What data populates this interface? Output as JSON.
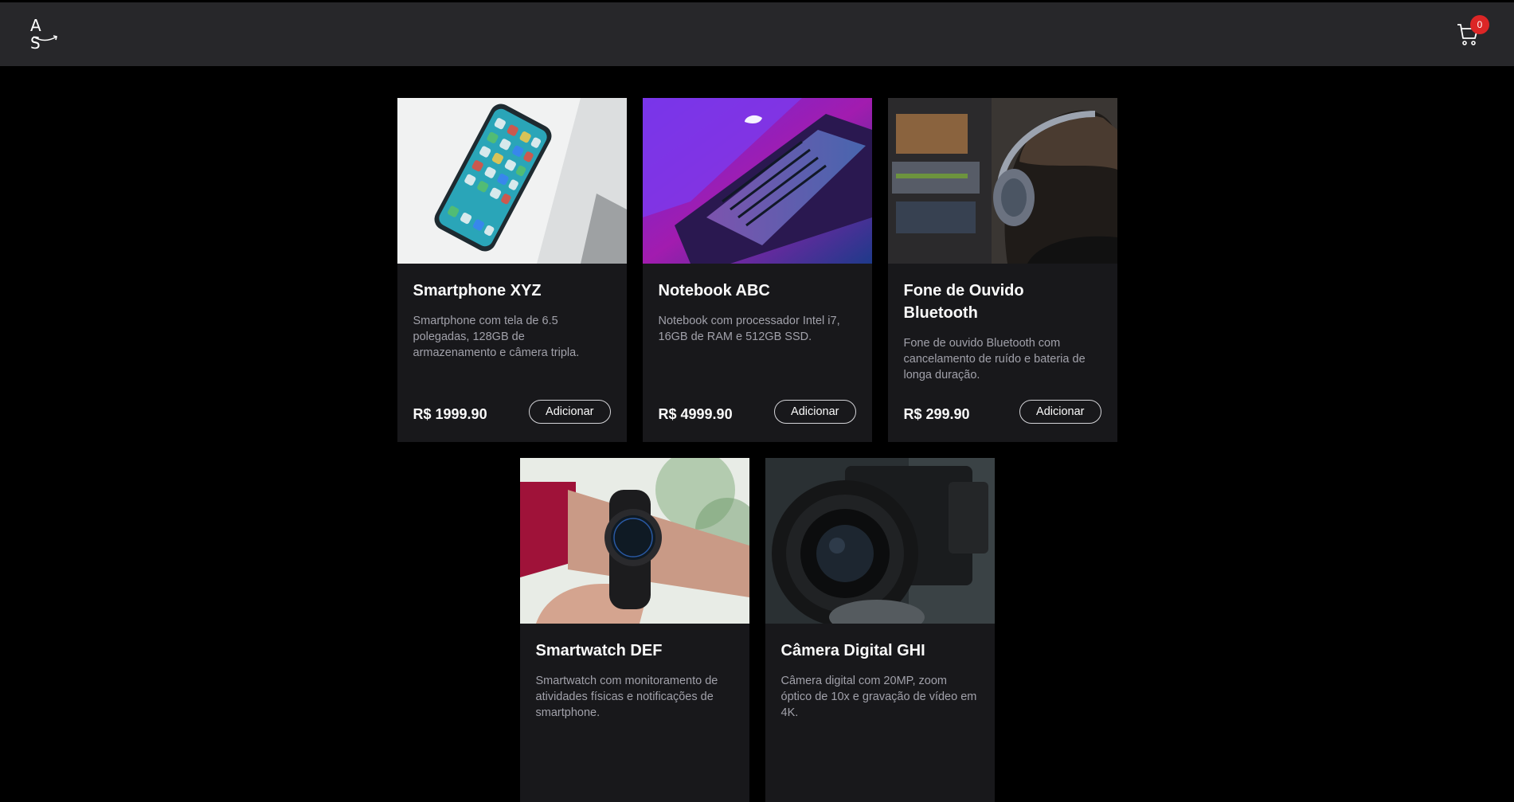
{
  "header": {
    "logo_text": "A S",
    "cart_count": "0",
    "cart_icon": "shopping-cart-icon"
  },
  "products": [
    {
      "name": "Smartphone XYZ",
      "description": "Smartphone com tela de 6.5 polegadas, 128GB de armazenamento e câmera tripla.",
      "price": "R$ 1999.90",
      "button": "Adicionar",
      "image": "smartphone-photo"
    },
    {
      "name": "Notebook ABC",
      "description": "Notebook com processador Intel i7, 16GB de RAM e 512GB SSD.",
      "price": "R$ 4999.90",
      "button": "Adicionar",
      "image": "laptop-photo"
    },
    {
      "name": "Fone de Ouvido Bluetooth",
      "description": "Fone de ouvido Bluetooth com cancelamento de ruído e bateria de longa duração.",
      "price": "R$ 299.90",
      "button": "Adicionar",
      "image": "headphones-photo"
    },
    {
      "name": "Smartwatch DEF",
      "description": "Smartwatch com monitoramento de atividades físicas e notificações de smartphone.",
      "price": "",
      "button": "",
      "image": "smartwatch-photo"
    },
    {
      "name": "Câmera Digital GHI",
      "description": "Câmera digital com 20MP, zoom óptico de 10x e gravação de vídeo em 4K.",
      "price": "",
      "button": "",
      "image": "camera-photo"
    }
  ],
  "colors": {
    "background": "#000000",
    "navbar": "#27272a",
    "card": "#18181b",
    "badge": "#dc2626"
  }
}
